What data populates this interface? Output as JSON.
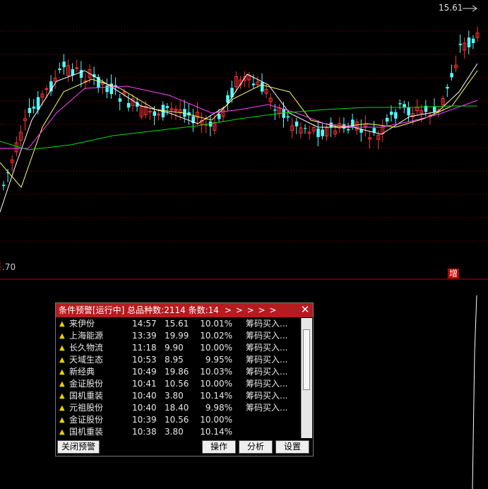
{
  "chart": {
    "last_price_label": "15.61",
    "low_label": ".70",
    "volume_badge": "增",
    "colors": {
      "up": "#ff3232",
      "down": "#54ffff",
      "ma5": "#ffffff",
      "ma10": "#ffff66",
      "ma20": "#ff44ff",
      "ma60": "#00e000",
      "grid": "#a00000"
    }
  },
  "alert_window": {
    "title": "条件预警[运行中] 总品种数:2114 条数:14",
    "arrows": "> > > > >",
    "rows": [
      {
        "name": "来伊份",
        "time": "14:57",
        "price": "15.61",
        "pct": "10.01%",
        "signal": "筹码买入..."
      },
      {
        "name": "上海能源",
        "time": "13:39",
        "price": "19.99",
        "pct": "10.02%",
        "signal": "筹码买入..."
      },
      {
        "name": "长久物流",
        "time": "11:18",
        "price": "9.90",
        "pct": "10.00%",
        "signal": "筹码买入..."
      },
      {
        "name": "天域生态",
        "time": "10:53",
        "price": "8.95",
        "pct": "9.95%",
        "signal": "筹码买入..."
      },
      {
        "name": "新经典",
        "time": "10:49",
        "price": "19.86",
        "pct": "10.03%",
        "signal": "筹码买入..."
      },
      {
        "name": "金证股份",
        "time": "10:41",
        "price": "10.56",
        "pct": "10.00%",
        "signal": "筹码买入..."
      },
      {
        "name": "国机重装",
        "time": "10:40",
        "price": "3.80",
        "pct": "10.14%",
        "signal": "筹码买入..."
      },
      {
        "name": "元祖股份",
        "time": "10:40",
        "price": "18.40",
        "pct": "9.98%",
        "signal": "筹码买入..."
      },
      {
        "name": "金证股份",
        "time": "10:39",
        "price": "10.56",
        "pct": "10.00%",
        "signal": ""
      },
      {
        "name": "国机重装",
        "time": "10:38",
        "price": "3.80",
        "pct": "10.14%",
        "signal": ""
      }
    ],
    "buttons": {
      "close_alert": "关闭预警",
      "operate": "操作",
      "analyze": "分析",
      "settings": "设置"
    }
  }
}
